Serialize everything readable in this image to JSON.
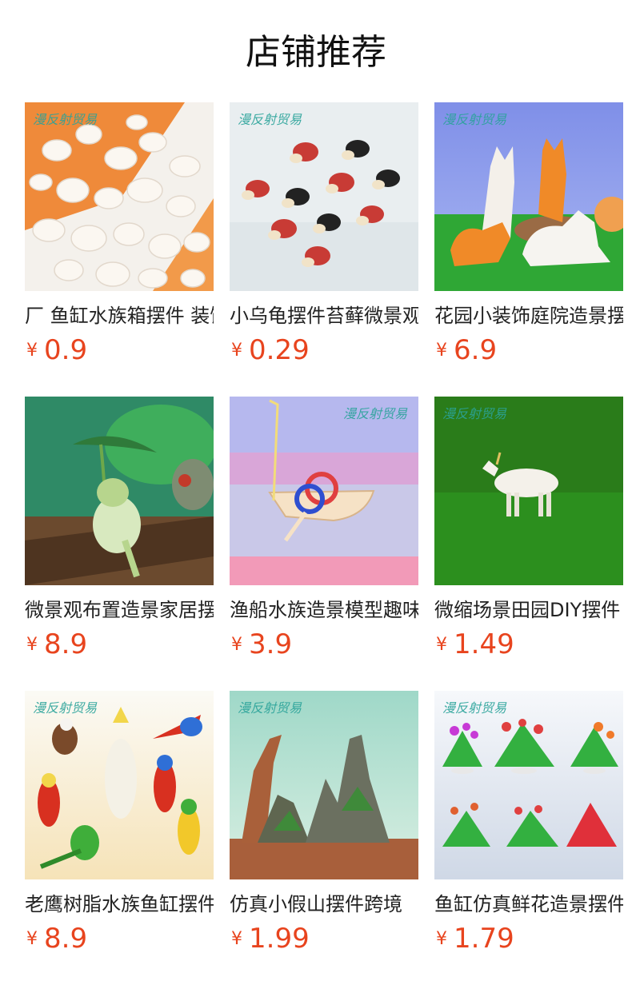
{
  "section_title": "店铺推荐",
  "watermark": "漫反射贸易",
  "products": [
    {
      "name": "厂 鱼缸水族箱摆件 装饰",
      "currency": "¥",
      "price": "0.9",
      "image": "white-seashells-image"
    },
    {
      "name": "小乌龟摆件苔藓微景观",
      "currency": "¥",
      "price": "0.29",
      "image": "mini-turtles-image"
    },
    {
      "name": "花园小装饰庭院造景摆件",
      "currency": "¥",
      "price": "6.9",
      "image": "fox-figurines-image"
    },
    {
      "name": "微景观布置造景家居摆件",
      "currency": "¥",
      "price": "8.9",
      "image": "frog-leaf-umbrella-image"
    },
    {
      "name": "渔船水族造景模型趣味",
      "currency": "¥",
      "price": "3.9",
      "image": "fishing-boat-image"
    },
    {
      "name": "微缩场景田园DIY摆件",
      "currency": "¥",
      "price": "1.49",
      "image": "goat-figurine-image"
    },
    {
      "name": "老鹰树脂水族鱼缸摆件",
      "currency": "¥",
      "price": "8.9",
      "image": "parrot-eagle-figurines-image"
    },
    {
      "name": "仿真小假山摆件跨境",
      "currency": "¥",
      "price": "1.99",
      "image": "rockery-mountain-image"
    },
    {
      "name": "鱼缸仿真鲜花造景摆件",
      "currency": "¥",
      "price": "1.79",
      "image": "artificial-flowers-image"
    }
  ]
}
